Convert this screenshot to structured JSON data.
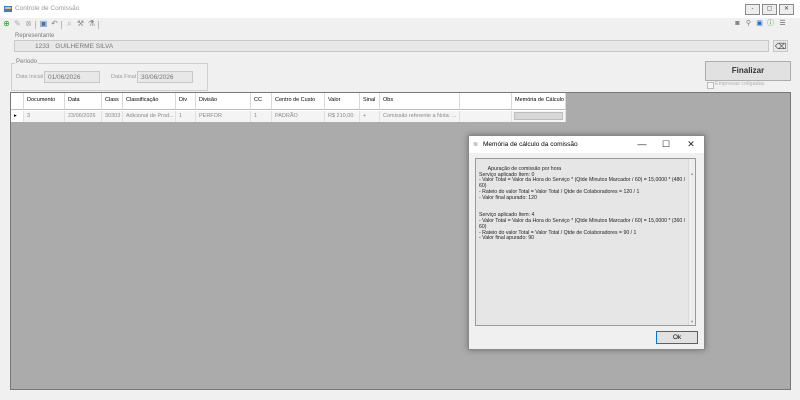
{
  "window": {
    "title": "Controle de Comissão",
    "controls": [
      "-",
      "▢",
      "✕"
    ]
  },
  "representante": {
    "group_label": "Representante",
    "code": "1233",
    "name": "GUILHERME SILVA"
  },
  "periodo": {
    "group_label": "Período",
    "inicial_label": "Data Inicial",
    "inicial_value": "01/06/2026",
    "final_label": "Data Final",
    "final_value": "30/06/2026"
  },
  "actions": {
    "finalizar_label": "Finalizar",
    "empresas_coligadas_label": "Empresas coligadas"
  },
  "grid": {
    "columns": [
      "Documento",
      "Data",
      "Class",
      "Classificação",
      "Div",
      "Divisão",
      "CC",
      "Centro de Custo",
      "Valor",
      "Sinal",
      "Obs",
      "",
      "Memória de Cálculo"
    ],
    "rows": [
      {
        "indicator": "▸",
        "cells": [
          "3",
          "23/06/2026",
          "30303",
          "Adicional de Prod...",
          "1",
          "PERFOR",
          "1",
          "PADRÃO",
          "R$ 210,00",
          "+",
          "Comissão referente a Nota: ...",
          "",
          ""
        ]
      }
    ]
  },
  "dialog": {
    "title": "Memória de cálculo da comissão",
    "controls": [
      "—",
      "☐",
      "✕"
    ],
    "memo": "Apuração de comissão por hora\nServiço aplicado Item: 0\n- Valor Total = Valor da Hora do Serviço * (Qtde Minutos Marcador / 60) = 15,0000 * (480 / 60)\n- Rateio do valor Total = Valor Total / Qtde de Colaboradores = 120 / 1\n- Valor final apurado: 120\n\n\nServiço aplicado Item: 4\n- Valor Total = Valor da Hora do Serviço * (Qtde Minutos Marcador / 60) = 15,0000 * (360 / 60)\n- Rateio do valor Total = Valor Total / Qtde de Colaboradores = 90 / 1\n- Valor final apurado: 90",
    "ok_label": "Ok"
  }
}
